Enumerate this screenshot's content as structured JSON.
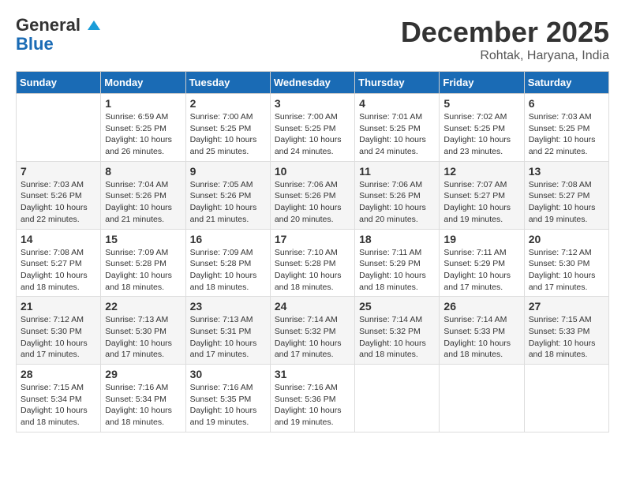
{
  "header": {
    "logo_line1": "General",
    "logo_line2": "Blue",
    "month": "December 2025",
    "location": "Rohtak, Haryana, India"
  },
  "weekdays": [
    "Sunday",
    "Monday",
    "Tuesday",
    "Wednesday",
    "Thursday",
    "Friday",
    "Saturday"
  ],
  "weeks": [
    [
      {
        "day": "",
        "sunrise": "",
        "sunset": "",
        "daylight": ""
      },
      {
        "day": "1",
        "sunrise": "Sunrise: 6:59 AM",
        "sunset": "Sunset: 5:25 PM",
        "daylight": "Daylight: 10 hours and 26 minutes."
      },
      {
        "day": "2",
        "sunrise": "Sunrise: 7:00 AM",
        "sunset": "Sunset: 5:25 PM",
        "daylight": "Daylight: 10 hours and 25 minutes."
      },
      {
        "day": "3",
        "sunrise": "Sunrise: 7:00 AM",
        "sunset": "Sunset: 5:25 PM",
        "daylight": "Daylight: 10 hours and 24 minutes."
      },
      {
        "day": "4",
        "sunrise": "Sunrise: 7:01 AM",
        "sunset": "Sunset: 5:25 PM",
        "daylight": "Daylight: 10 hours and 24 minutes."
      },
      {
        "day": "5",
        "sunrise": "Sunrise: 7:02 AM",
        "sunset": "Sunset: 5:25 PM",
        "daylight": "Daylight: 10 hours and 23 minutes."
      },
      {
        "day": "6",
        "sunrise": "Sunrise: 7:03 AM",
        "sunset": "Sunset: 5:25 PM",
        "daylight": "Daylight: 10 hours and 22 minutes."
      }
    ],
    [
      {
        "day": "7",
        "sunrise": "Sunrise: 7:03 AM",
        "sunset": "Sunset: 5:26 PM",
        "daylight": "Daylight: 10 hours and 22 minutes."
      },
      {
        "day": "8",
        "sunrise": "Sunrise: 7:04 AM",
        "sunset": "Sunset: 5:26 PM",
        "daylight": "Daylight: 10 hours and 21 minutes."
      },
      {
        "day": "9",
        "sunrise": "Sunrise: 7:05 AM",
        "sunset": "Sunset: 5:26 PM",
        "daylight": "Daylight: 10 hours and 21 minutes."
      },
      {
        "day": "10",
        "sunrise": "Sunrise: 7:06 AM",
        "sunset": "Sunset: 5:26 PM",
        "daylight": "Daylight: 10 hours and 20 minutes."
      },
      {
        "day": "11",
        "sunrise": "Sunrise: 7:06 AM",
        "sunset": "Sunset: 5:26 PM",
        "daylight": "Daylight: 10 hours and 20 minutes."
      },
      {
        "day": "12",
        "sunrise": "Sunrise: 7:07 AM",
        "sunset": "Sunset: 5:27 PM",
        "daylight": "Daylight: 10 hours and 19 minutes."
      },
      {
        "day": "13",
        "sunrise": "Sunrise: 7:08 AM",
        "sunset": "Sunset: 5:27 PM",
        "daylight": "Daylight: 10 hours and 19 minutes."
      }
    ],
    [
      {
        "day": "14",
        "sunrise": "Sunrise: 7:08 AM",
        "sunset": "Sunset: 5:27 PM",
        "daylight": "Daylight: 10 hours and 18 minutes."
      },
      {
        "day": "15",
        "sunrise": "Sunrise: 7:09 AM",
        "sunset": "Sunset: 5:28 PM",
        "daylight": "Daylight: 10 hours and 18 minutes."
      },
      {
        "day": "16",
        "sunrise": "Sunrise: 7:09 AM",
        "sunset": "Sunset: 5:28 PM",
        "daylight": "Daylight: 10 hours and 18 minutes."
      },
      {
        "day": "17",
        "sunrise": "Sunrise: 7:10 AM",
        "sunset": "Sunset: 5:28 PM",
        "daylight": "Daylight: 10 hours and 18 minutes."
      },
      {
        "day": "18",
        "sunrise": "Sunrise: 7:11 AM",
        "sunset": "Sunset: 5:29 PM",
        "daylight": "Daylight: 10 hours and 18 minutes."
      },
      {
        "day": "19",
        "sunrise": "Sunrise: 7:11 AM",
        "sunset": "Sunset: 5:29 PM",
        "daylight": "Daylight: 10 hours and 17 minutes."
      },
      {
        "day": "20",
        "sunrise": "Sunrise: 7:12 AM",
        "sunset": "Sunset: 5:30 PM",
        "daylight": "Daylight: 10 hours and 17 minutes."
      }
    ],
    [
      {
        "day": "21",
        "sunrise": "Sunrise: 7:12 AM",
        "sunset": "Sunset: 5:30 PM",
        "daylight": "Daylight: 10 hours and 17 minutes."
      },
      {
        "day": "22",
        "sunrise": "Sunrise: 7:13 AM",
        "sunset": "Sunset: 5:30 PM",
        "daylight": "Daylight: 10 hours and 17 minutes."
      },
      {
        "day": "23",
        "sunrise": "Sunrise: 7:13 AM",
        "sunset": "Sunset: 5:31 PM",
        "daylight": "Daylight: 10 hours and 17 minutes."
      },
      {
        "day": "24",
        "sunrise": "Sunrise: 7:14 AM",
        "sunset": "Sunset: 5:32 PM",
        "daylight": "Daylight: 10 hours and 17 minutes."
      },
      {
        "day": "25",
        "sunrise": "Sunrise: 7:14 AM",
        "sunset": "Sunset: 5:32 PM",
        "daylight": "Daylight: 10 hours and 18 minutes."
      },
      {
        "day": "26",
        "sunrise": "Sunrise: 7:14 AM",
        "sunset": "Sunset: 5:33 PM",
        "daylight": "Daylight: 10 hours and 18 minutes."
      },
      {
        "day": "27",
        "sunrise": "Sunrise: 7:15 AM",
        "sunset": "Sunset: 5:33 PM",
        "daylight": "Daylight: 10 hours and 18 minutes."
      }
    ],
    [
      {
        "day": "28",
        "sunrise": "Sunrise: 7:15 AM",
        "sunset": "Sunset: 5:34 PM",
        "daylight": "Daylight: 10 hours and 18 minutes."
      },
      {
        "day": "29",
        "sunrise": "Sunrise: 7:16 AM",
        "sunset": "Sunset: 5:34 PM",
        "daylight": "Daylight: 10 hours and 18 minutes."
      },
      {
        "day": "30",
        "sunrise": "Sunrise: 7:16 AM",
        "sunset": "Sunset: 5:35 PM",
        "daylight": "Daylight: 10 hours and 19 minutes."
      },
      {
        "day": "31",
        "sunrise": "Sunrise: 7:16 AM",
        "sunset": "Sunset: 5:36 PM",
        "daylight": "Daylight: 10 hours and 19 minutes."
      },
      {
        "day": "",
        "sunrise": "",
        "sunset": "",
        "daylight": ""
      },
      {
        "day": "",
        "sunrise": "",
        "sunset": "",
        "daylight": ""
      },
      {
        "day": "",
        "sunrise": "",
        "sunset": "",
        "daylight": ""
      }
    ]
  ]
}
